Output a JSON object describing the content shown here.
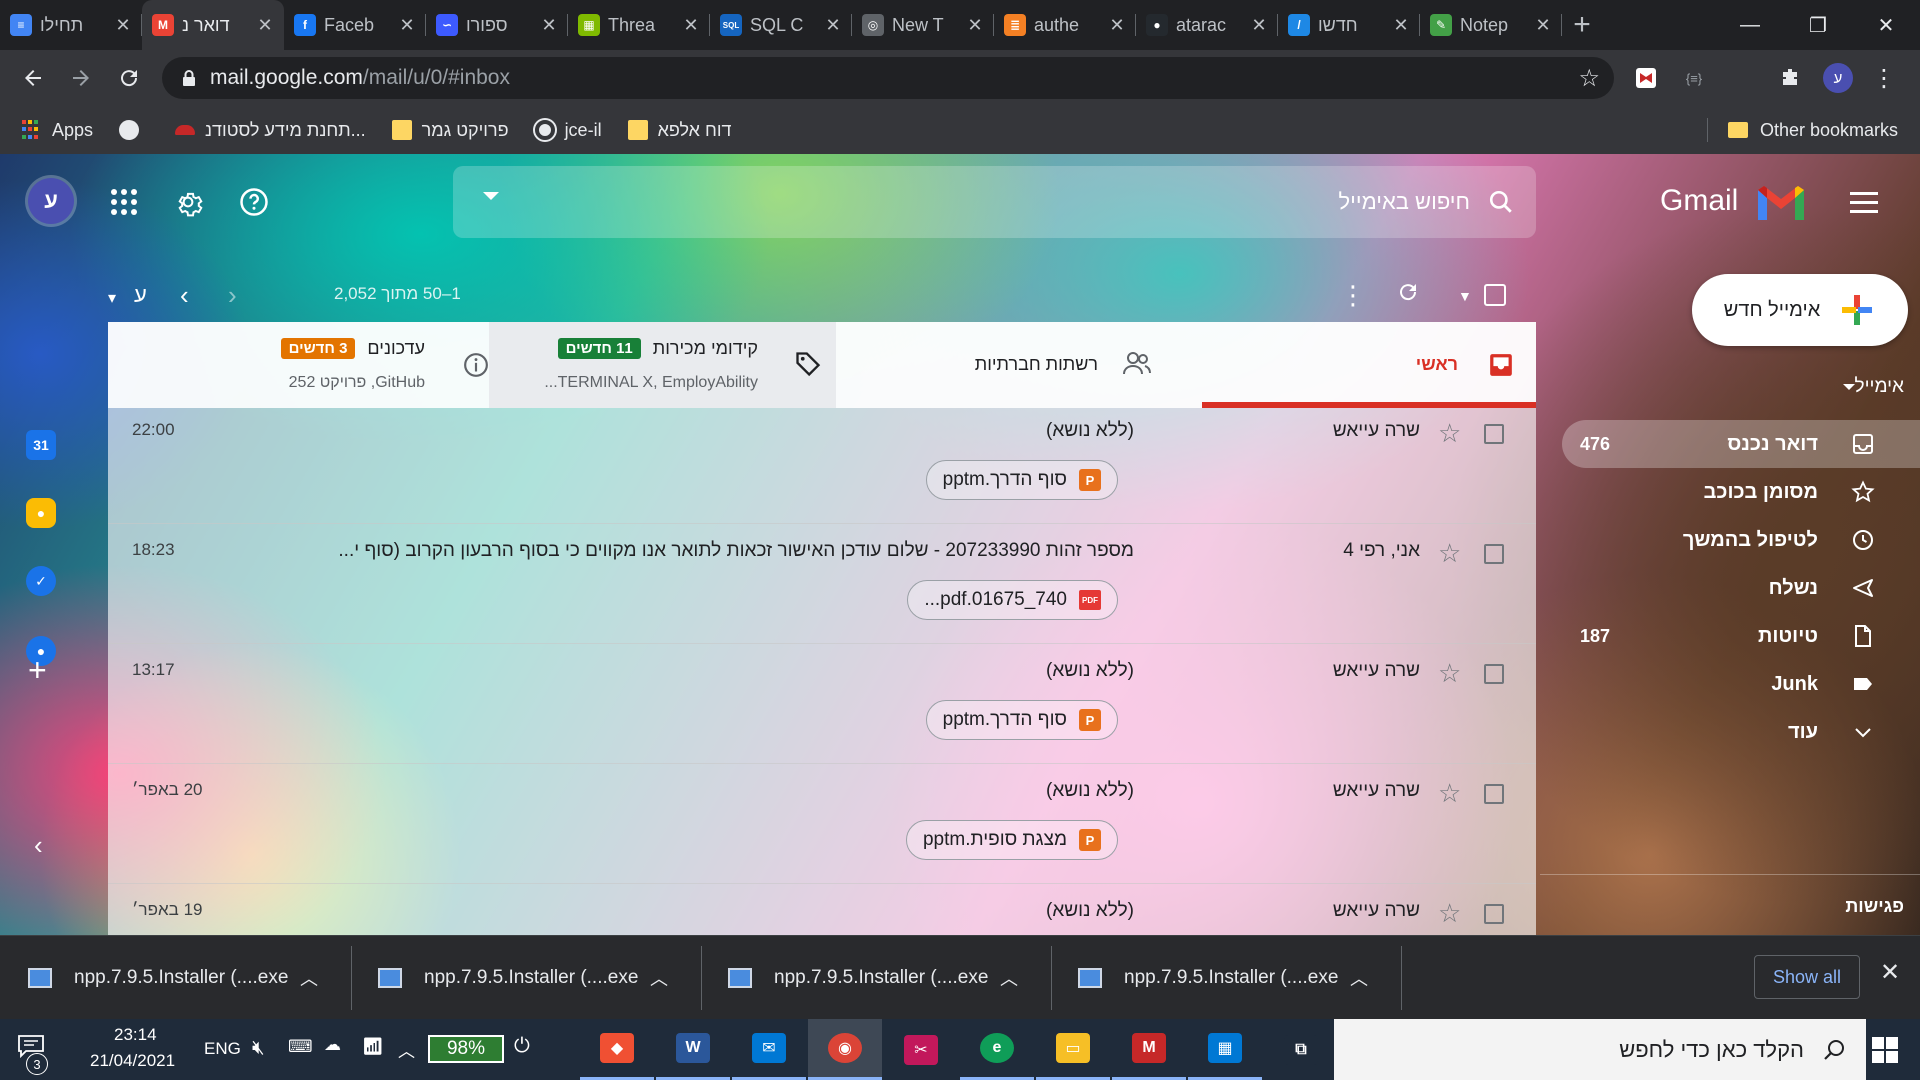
{
  "browser": {
    "tabs": [
      {
        "title": "תחילו",
        "icon": "google-docs-icon",
        "color": "#4285f4",
        "glyph": "≡"
      },
      {
        "title": "דואר נ",
        "icon": "gmail-icon",
        "color": "#ea4335",
        "glyph": "M",
        "active": true
      },
      {
        "title": "Faceb",
        "icon": "facebook-icon",
        "color": "#1877f2",
        "glyph": "f"
      },
      {
        "title": "ספורו",
        "icon": "spiral-icon",
        "color": "#3d5afe",
        "glyph": "∽"
      },
      {
        "title": "Threa",
        "icon": "microsoft-icon",
        "color": "#7fba00",
        "glyph": "▦"
      },
      {
        "title": "SQL C",
        "icon": "sql-icon",
        "color": "#1565c0",
        "glyph": "SQL"
      },
      {
        "title": "New T",
        "icon": "new-tab-icon",
        "color": "#5f6368",
        "glyph": "◎"
      },
      {
        "title": "authe",
        "icon": "stack-overflow-icon",
        "color": "#f48024",
        "glyph": "≣"
      },
      {
        "title": "atarac",
        "icon": "github-icon",
        "color": "#24292e",
        "glyph": "●"
      },
      {
        "title": "חדשו",
        "icon": "blue-app-icon",
        "color": "#1e88e5",
        "glyph": "/"
      },
      {
        "title": "Notep",
        "icon": "notepad-icon",
        "color": "#43a047",
        "glyph": "✎"
      }
    ],
    "new_tab_label": "+",
    "window_controls": {
      "minimize": "—",
      "restore": "❐",
      "close": "✕"
    },
    "address": {
      "host": "mail.google.com",
      "path": "/mail/u/0/#inbox"
    },
    "profile_initial": "ע",
    "bookmarks": [
      {
        "label": "Apps",
        "icon": "apps-grid-icon"
      },
      {
        "label": "",
        "icon": "globe-icon"
      },
      {
        "label": "תחנת מידע לסטודנ...",
        "icon": "red-logo-icon"
      },
      {
        "label": "פרויקט גמר",
        "icon": "folder-icon"
      },
      {
        "label": "jce-il",
        "icon": "github-icon"
      },
      {
        "label": "דוח אלפא",
        "icon": "folder-icon"
      }
    ],
    "other_bookmarks": "Other bookmarks"
  },
  "gmail": {
    "account_initial": "ע",
    "search_placeholder": "חיפוש באימייל",
    "logo_text": "Gmail",
    "compose_label": "אימייל חדש",
    "section_label": "אימייל",
    "folders": [
      {
        "label": "דואר נכנס",
        "count": "476",
        "icon": "inbox-icon",
        "active": true
      },
      {
        "label": "מסומן בכוכב",
        "count": "",
        "icon": "star-icon"
      },
      {
        "label": "לטיפול בהמשך",
        "count": "",
        "icon": "clock-icon"
      },
      {
        "label": "נשלח",
        "count": "",
        "icon": "send-icon"
      },
      {
        "label": "טיוטות",
        "count": "187",
        "icon": "draft-icon"
      },
      {
        "label": "Junk",
        "count": "",
        "icon": "label-icon"
      },
      {
        "label": "עוד",
        "count": "",
        "icon": "chevron-down-icon"
      }
    ],
    "meetings_label": "פגישות",
    "pagination": "1–50 מתוך 2,052",
    "input_tool": "ע",
    "inbox_tabs": {
      "primary": {
        "title": "ראשי"
      },
      "social": {
        "title": "רשתות חברתיות"
      },
      "promotions": {
        "title": "קידומי מכירות",
        "badge": "11 חדשים",
        "badge_color": "#188038",
        "subtitle": "TERMINAL X, EmployAbility..."
      },
      "updates": {
        "title": "עדכונים",
        "badge": "3 חדשים",
        "badge_color": "#e37400",
        "subtitle": "GitHub, פרויקט 252"
      }
    },
    "emails": [
      {
        "sender": "שרה עייאש",
        "subject": "(ללא נושא)",
        "time": "22:00",
        "attachment": "סוף הדרך.pptm",
        "attachment_type": "ppt"
      },
      {
        "sender": "אני, רפי 4",
        "subject": "מספר זהות 207233990 - שלום עודכן האישור זכאות לתואר אנו מקווים כי בסוף הרבעון הקרוב (סוף י...",
        "time": "18:23",
        "attachment": "740_01675.pdf...",
        "attachment_type": "pdf"
      },
      {
        "sender": "שרה עייאש",
        "subject": "(ללא נושא)",
        "time": "13:17",
        "attachment": "סוף הדרך.pptm",
        "attachment_type": "ppt"
      },
      {
        "sender": "שרה עייאש",
        "subject": "(ללא נושא)",
        "time": "20 באפר׳",
        "attachment": "מצגת סופית.pptm",
        "attachment_type": "ppt"
      },
      {
        "sender": "שרה עייאש",
        "subject": "(ללא נושא)",
        "time": "19 באפר׳",
        "attachment": "",
        "attachment_type": ""
      }
    ]
  },
  "downloads": {
    "items": [
      {
        "name": "npp.7.9.5.Installer (....exe"
      },
      {
        "name": "npp.7.9.5.Installer (....exe"
      },
      {
        "name": "npp.7.9.5.Installer (....exe"
      },
      {
        "name": "npp.7.9.5.Installer (....exe"
      }
    ],
    "show_all": "Show all"
  },
  "taskbar": {
    "search_placeholder": "הקלד כאן כדי לחפש",
    "time": "23:14",
    "date": "21/04/2021",
    "language": "ENG",
    "battery": "98%",
    "notifications": "3",
    "apps": [
      {
        "name": "git-icon",
        "color": "#f05033",
        "glyph": "◆"
      },
      {
        "name": "word-icon",
        "color": "#2b579a",
        "glyph": "W"
      },
      {
        "name": "mail-icon",
        "color": "#0078d4",
        "glyph": "✉"
      },
      {
        "name": "chrome-icon",
        "color": "#db4437",
        "glyph": "◉",
        "active": true
      },
      {
        "name": "snip-icon",
        "color": "#c2185b",
        "glyph": "✂"
      },
      {
        "name": "edge-icon",
        "color": "#0f9d58",
        "glyph": "e"
      },
      {
        "name": "file-explorer-icon",
        "color": "#f6bf26",
        "glyph": "▭"
      },
      {
        "name": "mcafee-icon",
        "color": "#c62828",
        "glyph": "M"
      },
      {
        "name": "store-icon",
        "color": "#0078d4",
        "glyph": "▦"
      },
      {
        "name": "task-view-icon",
        "color": "#1f2b3a",
        "glyph": "⧉"
      }
    ]
  }
}
